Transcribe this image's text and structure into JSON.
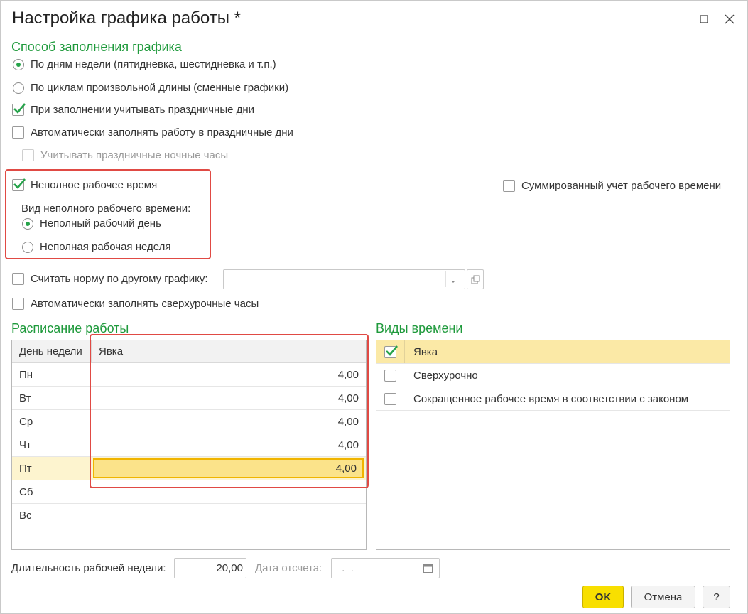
{
  "window": {
    "title": "Настройка графика работы *"
  },
  "fill_method": {
    "heading": "Способ заполнения графика",
    "radio_weekdays": "По дням недели (пятидневка, шестидневка и т.п.)",
    "radio_cycles": "По циклам произвольной длины (сменные графики)",
    "cb_holidays": "При заполнении учитывать праздничные дни",
    "cb_auto_holiday_work": "Автоматически заполнять работу в праздничные дни",
    "cb_holiday_night": "Учитывать праздничные ночные часы"
  },
  "part_time": {
    "cb_label": "Неполное рабочее время",
    "type_label": "Вид неполного рабочего времени:",
    "radio_day": "Неполный рабочий день",
    "radio_week": "Неполная рабочая неделя"
  },
  "summarized": {
    "cb_label": "Суммированный учет рабочего времени"
  },
  "norm": {
    "cb_label": "Считать норму по другому графику:",
    "value": ""
  },
  "overtime": {
    "cb_label": "Автоматически заполнять сверхурочные часы"
  },
  "schedule": {
    "heading": "Расписание работы",
    "col_day": "День недели",
    "col_value": "Явка",
    "rows": [
      {
        "day": "Пн",
        "value": "4,00"
      },
      {
        "day": "Вт",
        "value": "4,00"
      },
      {
        "day": "Ср",
        "value": "4,00"
      },
      {
        "day": "Чт",
        "value": "4,00"
      },
      {
        "day": "Пт",
        "value": "4,00"
      },
      {
        "day": "Сб",
        "value": ""
      },
      {
        "day": "Вс",
        "value": ""
      }
    ]
  },
  "time_types": {
    "heading": "Виды времени",
    "items": [
      {
        "label": "Явка",
        "checked": true
      },
      {
        "label": "Сверхурочно",
        "checked": false
      },
      {
        "label": "Сокращенное рабочее время в соответствии с законом",
        "checked": false
      }
    ]
  },
  "footer": {
    "week_length_label": "Длительность рабочей недели:",
    "week_length_value": "20,00",
    "ref_date_label": "Дата отсчета:",
    "ref_date_value": " .  .",
    "ok": "OK",
    "cancel": "Отмена",
    "help": "?"
  },
  "colors": {
    "accent_green": "#1f9a3c",
    "highlight_yellow": "#fbe9a6",
    "ok_yellow": "#f8df00",
    "annotation_red": "#e04a44"
  },
  "icons": [
    "maximize-icon",
    "close-icon",
    "check-icon",
    "dropdown-arrow-icon",
    "open-form-icon",
    "calendar-icon"
  ]
}
